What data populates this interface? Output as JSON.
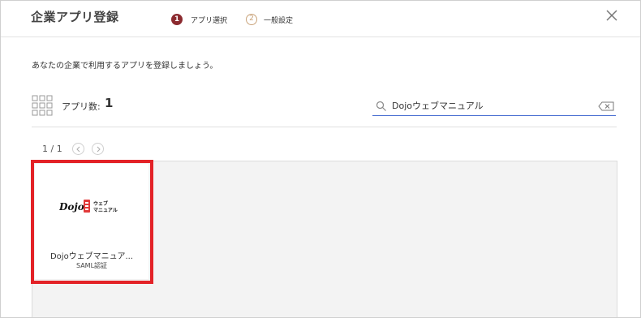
{
  "header": {
    "title": "企業アプリ登録",
    "steps": [
      {
        "number": "1",
        "label": "アプリ選択"
      },
      {
        "number": "2",
        "label": "一般設定"
      }
    ]
  },
  "description": "あなたの企業で利用するアプリを登録しましょう。",
  "app_count": {
    "label": "アプリ数:",
    "value": "1"
  },
  "search": {
    "value": "Dojoウェブマニュアル"
  },
  "pager": {
    "text": "1 / 1"
  },
  "apps": [
    {
      "name": "Dojoウェブマニュア...",
      "auth": "SAML認証",
      "logo_text": "Dojo",
      "logo_subtext": "ウェブ マニュアル"
    }
  ],
  "colors": {
    "step_active": "#8b2a2f",
    "step_inactive": "#c9a37a",
    "search_underline": "#4a6fd1",
    "highlight": "#e32227"
  }
}
